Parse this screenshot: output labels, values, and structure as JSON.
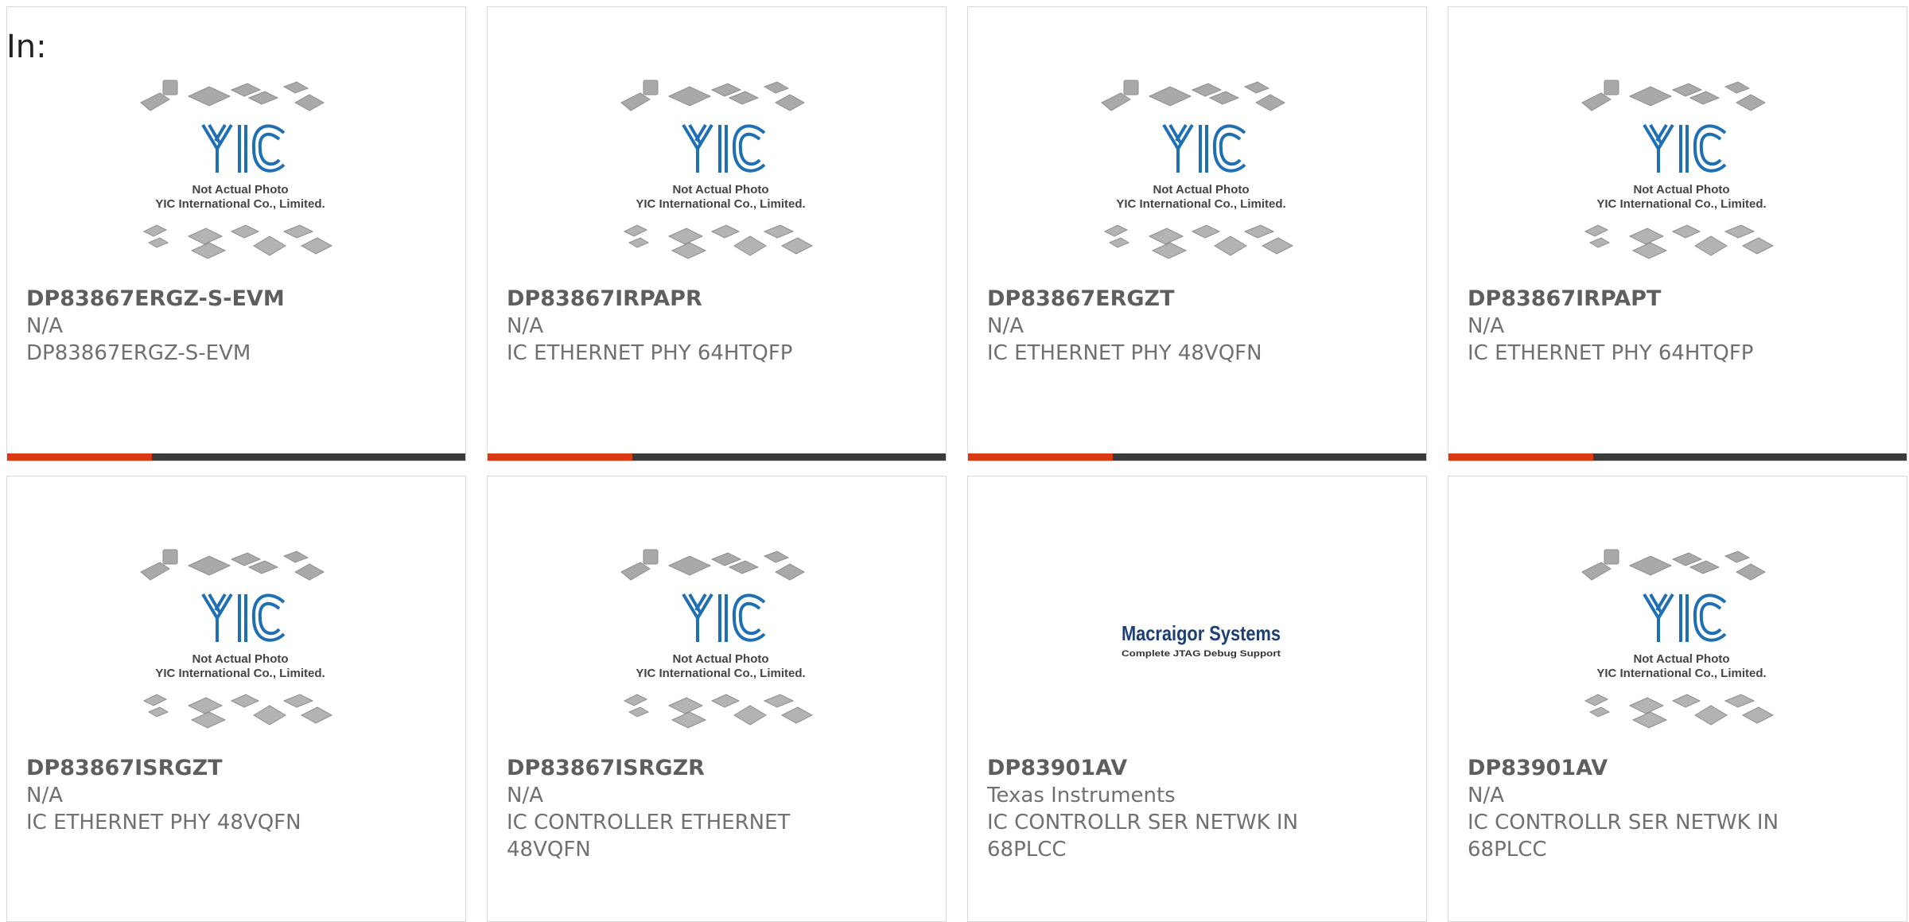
{
  "prefix_label": "In:",
  "placeholder": {
    "line1": "Not Actual Photo",
    "line2": "YIC International Co., Limited."
  },
  "vendor_logo": {
    "name": "Macraigor Systems",
    "tagline": "Complete JTAG Debug Support"
  },
  "colors": {
    "accent": "#d93a14",
    "bar": "#3b3b3b",
    "logo_blue": "#1f6fb5"
  },
  "products": [
    {
      "part": "DP83867ERGZ-S-EVM",
      "maker": "N/A",
      "desc1": "DP83867ERGZ-S-EVM",
      "desc2": "",
      "image": "placeholder"
    },
    {
      "part": "DP83867IRPAPR",
      "maker": "N/A",
      "desc1": "IC ETHERNET PHY 64HTQFP",
      "desc2": "",
      "image": "placeholder"
    },
    {
      "part": "DP83867ERGZT",
      "maker": "N/A",
      "desc1": "IC ETHERNET PHY 48VQFN",
      "desc2": "",
      "image": "placeholder"
    },
    {
      "part": "DP83867IRPAPT",
      "maker": "N/A",
      "desc1": "IC ETHERNET PHY 64HTQFP",
      "desc2": "",
      "image": "placeholder"
    },
    {
      "part": "DP83867ISRGZT",
      "maker": "N/A",
      "desc1": "IC ETHERNET PHY 48VQFN",
      "desc2": "",
      "image": "placeholder"
    },
    {
      "part": "DP83867ISRGZR",
      "maker": "N/A",
      "desc1": "IC CONTROLLER ETHERNET",
      "desc2": "48VQFN",
      "image": "placeholder"
    },
    {
      "part": "DP83901AV",
      "maker": "Texas Instruments",
      "desc1": "IC CONTROLLR SER NETWK IN",
      "desc2": "68PLCC",
      "image": "vendor-logo"
    },
    {
      "part": "DP83901AV",
      "maker": "N/A",
      "desc1": "IC CONTROLLR SER NETWK IN",
      "desc2": "68PLCC",
      "image": "placeholder"
    }
  ]
}
